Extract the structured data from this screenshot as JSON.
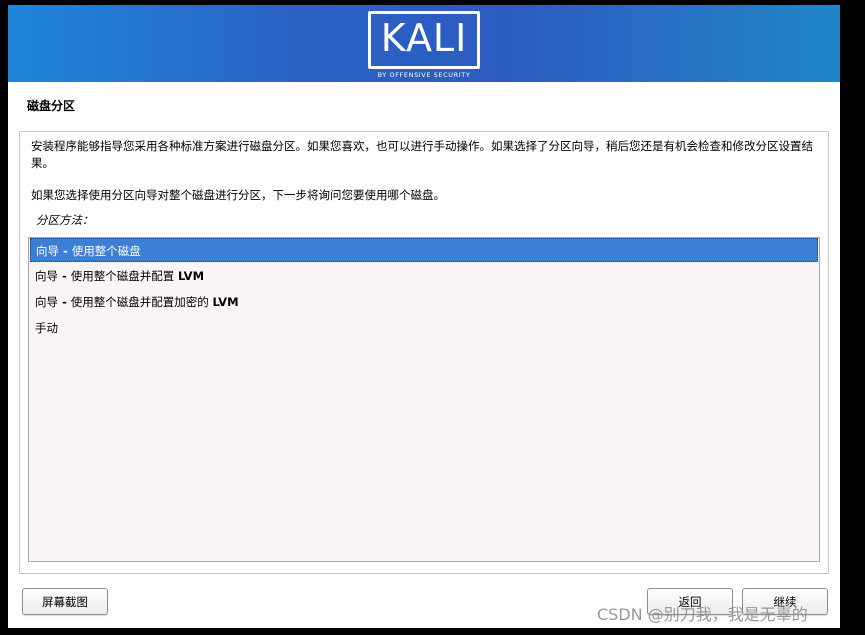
{
  "banner": {
    "logo_text": "KALI",
    "logo_subtitle": "BY OFFENSIVE SECURITY"
  },
  "page": {
    "title": "磁盘分区",
    "description": "安装程序能够指导您采用各种标准方案进行磁盘分区。如果您喜欢，也可以进行手动操作。如果选择了分区向导，稍后您还是有机会检查和修改分区设置结果。",
    "description2": "如果您选择使用分区向导对整个磁盘进行分区，下一步将询问您要使用哪个磁盘。",
    "method_label": "分区方法："
  },
  "options": [
    {
      "prefix": "向导",
      "sep": " - ",
      "text": "使用整个磁盘",
      "selected": true
    },
    {
      "prefix": "向导",
      "sep": " - ",
      "text": "使用整个磁盘并配置 ",
      "bold_tail": "LVM",
      "selected": false
    },
    {
      "prefix": "向导",
      "sep": " - ",
      "text": "使用整个磁盘并配置加密的 ",
      "bold_tail": "LVM",
      "selected": false
    },
    {
      "prefix": "手动",
      "sep": "",
      "text": "",
      "selected": false
    }
  ],
  "buttons": {
    "screenshot": "屏幕截图",
    "back": "返回",
    "continue": "继续"
  },
  "watermark": "CSDN @别刀我，我是无辜的",
  "colors": {
    "banner_start": "#1f86d9",
    "banner_end": "#2186c8",
    "selection": "#3c7fd7"
  }
}
